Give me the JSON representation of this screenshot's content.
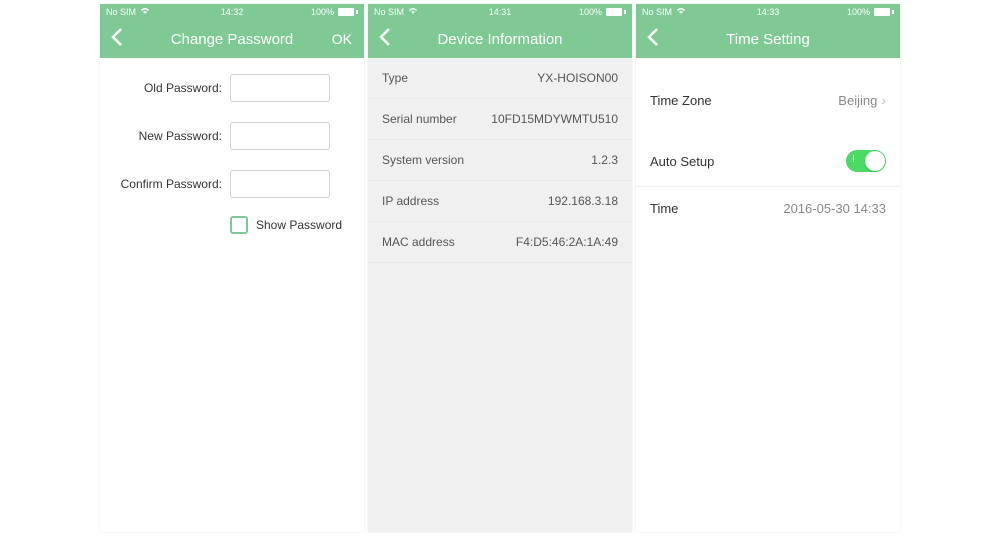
{
  "screens": [
    {
      "status": {
        "carrier": "No SIM",
        "time": "14:32",
        "battery": "100%"
      },
      "nav": {
        "title": "Change Password",
        "right": "OK"
      },
      "form": {
        "old": "Old Password:",
        "new": "New Password:",
        "confirm": "Confirm Password:",
        "show": "Show Password"
      }
    },
    {
      "status": {
        "carrier": "No SIM",
        "time": "14:31",
        "battery": "100%"
      },
      "nav": {
        "title": "Device Information"
      },
      "info": [
        {
          "label": "Type",
          "value": "YX-HOISON00"
        },
        {
          "label": "Serial number",
          "value": "10FD15MDYWMTU510"
        },
        {
          "label": "System version",
          "value": "1.2.3"
        },
        {
          "label": "IP address",
          "value": "192.168.3.18"
        },
        {
          "label": "MAC address",
          "value": "F4:D5:46:2A:1A:49"
        }
      ]
    },
    {
      "status": {
        "carrier": "No SIM",
        "time": "14:33",
        "battery": "100%"
      },
      "nav": {
        "title": "Time Setting"
      },
      "settings": {
        "timezone_label": "Time Zone",
        "timezone_value": "Beijing",
        "auto_label": "Auto Setup",
        "time_label": "Time",
        "time_value": "2016-05-30 14:33"
      }
    }
  ]
}
